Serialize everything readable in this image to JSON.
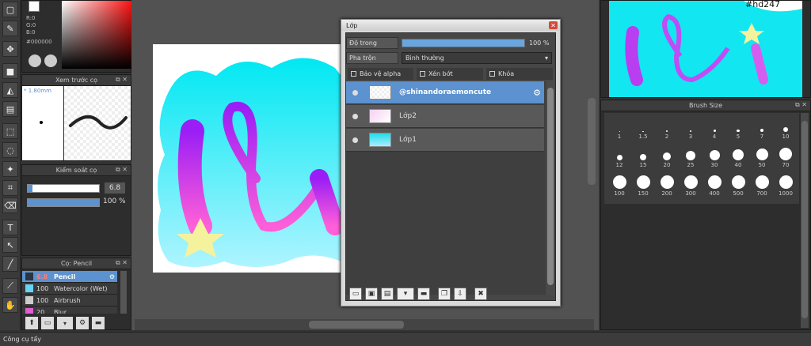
{
  "color": {
    "r": "R:0",
    "g": "G:0",
    "b": "B:0",
    "hex": "#000000"
  },
  "preview_panel": {
    "title": "Xem trước cọ",
    "size": "* 1.80mm"
  },
  "control_panel": {
    "title": "Kiểm soát cọ",
    "size_value": "6.8",
    "opacity_value": "100 %",
    "size_fraction": 0.07,
    "opacity_fraction": 1.0
  },
  "brush_panel": {
    "title": "Cọ: Pencil",
    "items": [
      {
        "size": "6.8",
        "name": "Pencil",
        "selected": true,
        "color": "#2c3440"
      },
      {
        "size": "100",
        "name": "Watercolor (Wet)",
        "selected": false,
        "color": "#66d4f4"
      },
      {
        "size": "100",
        "name": "Airbrush",
        "selected": false,
        "color": "#cccccc"
      },
      {
        "size": "20",
        "name": "Blur",
        "selected": false,
        "color": "#e25cd2"
      }
    ]
  },
  "layer_window": {
    "title": "Lớp",
    "opacity_label": "Độ trong",
    "opacity_value": "100 %",
    "opacity_fraction": 1.0,
    "blend_label": "Pha trộn",
    "blend_value": "Bình thường",
    "protect_alpha": "Bảo vệ alpha",
    "clipping": "Xén bớt",
    "lock": "Khóa",
    "layers": [
      {
        "name": "@shinandoraemoncute",
        "selected": true,
        "thumb": "purple"
      },
      {
        "name": "Lớp2",
        "selected": false,
        "thumb": "pink"
      },
      {
        "name": "Lớp1",
        "selected": false,
        "thumb": "cyan"
      }
    ]
  },
  "brush_size": {
    "title": "Brush Size",
    "sizes": [
      "1",
      "1.5",
      "2",
      "3",
      "4",
      "5",
      "7",
      "10",
      "12",
      "15",
      "20",
      "25",
      "30",
      "40",
      "50",
      "70",
      "100",
      "150",
      "200",
      "300",
      "400",
      "500",
      "700",
      "1000"
    ]
  },
  "status": {
    "text": "Công cụ tẩy"
  },
  "navigator": {
    "text": "#hd247"
  }
}
